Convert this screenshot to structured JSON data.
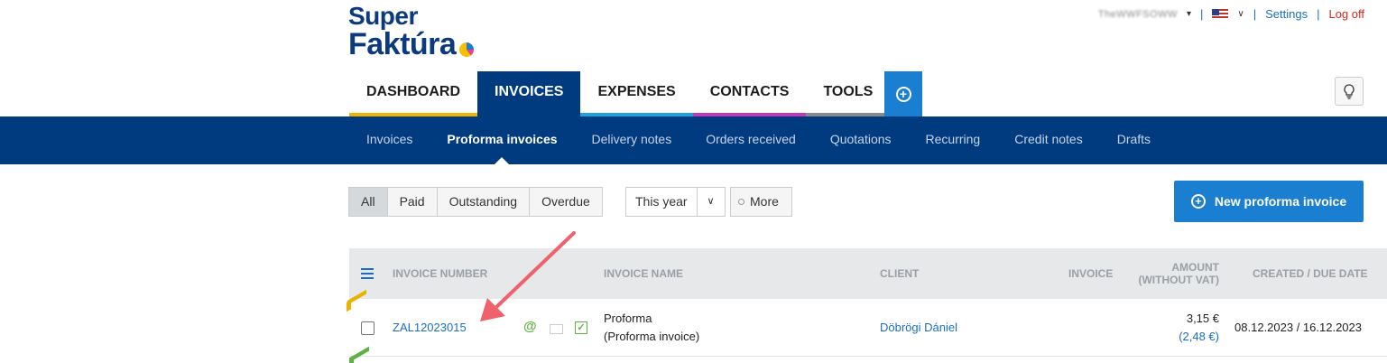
{
  "logo": {
    "line1": "Super",
    "line2": "Faktúra"
  },
  "topbar": {
    "user": "TheWWFSOWW",
    "settings": "Settings",
    "logout": "Log off"
  },
  "tabs": [
    "DASHBOARD",
    "INVOICES",
    "EXPENSES",
    "CONTACTS",
    "TOOLS"
  ],
  "subnav": [
    "Invoices",
    "Proforma invoices",
    "Delivery notes",
    "Orders received",
    "Quotations",
    "Recurring",
    "Credit notes",
    "Drafts"
  ],
  "filters": {
    "segments": [
      "All",
      "Paid",
      "Outstanding",
      "Overdue"
    ],
    "period": "This year",
    "more": "More"
  },
  "new_button": "New proforma invoice",
  "table": {
    "headers": {
      "number": "INVOICE NUMBER",
      "name": "INVOICE NAME",
      "client": "CLIENT",
      "invoice": "INVOICE",
      "amount_l1": "AMOUNT",
      "amount_l2": "(WITHOUT VAT)",
      "dates": "CREATED / DUE DATE"
    },
    "rows": [
      {
        "number": "ZAL12023015",
        "at": "@",
        "tick": "✓",
        "name_l1": "Proforma",
        "name_l2": "(Proforma invoice)",
        "client": "Döbrögi Dániel",
        "amount": "3,15 €",
        "amount_sub": "(2,48 €)",
        "dates": "08.12.2023 / 16.12.2023"
      }
    ]
  },
  "colors": {
    "brand": "#003b80",
    "accent": "#1a7fd0",
    "annotation_arrow": "#f0626b"
  }
}
